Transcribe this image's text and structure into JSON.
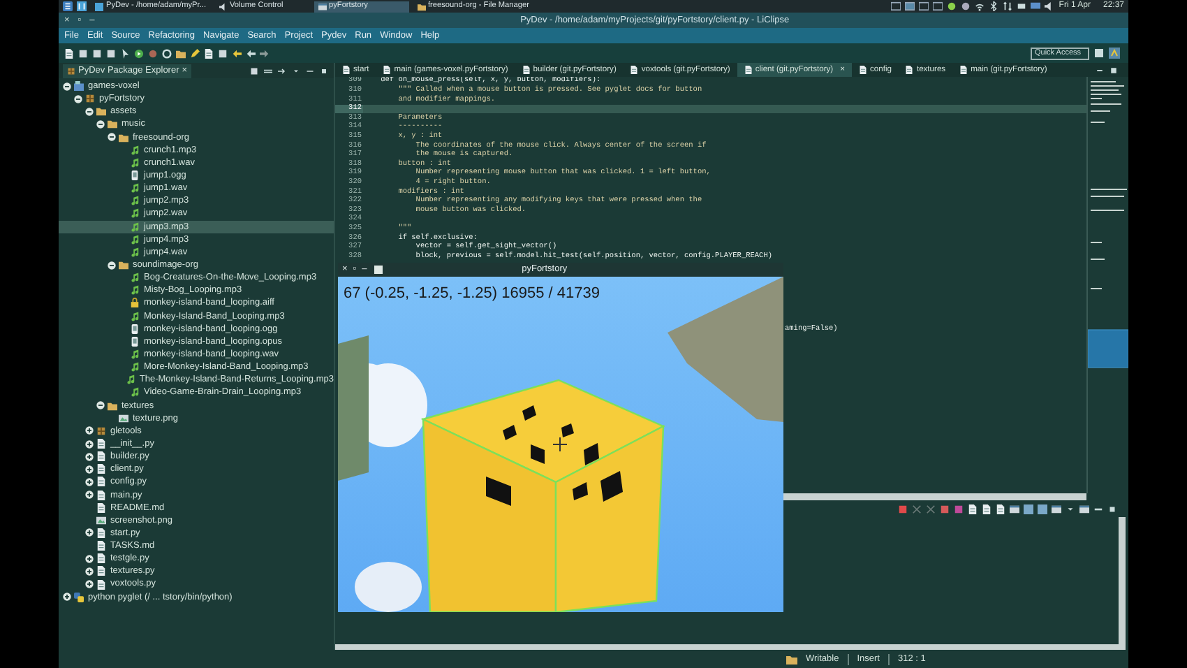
{
  "taskbar": {
    "windows": [
      {
        "title": "PyDev - /home/adam/myPr...",
        "selected": false
      },
      {
        "title": "Volume Control",
        "selected": false
      },
      {
        "title": "pyFortstory",
        "selected": true
      },
      {
        "title": "freesound-org - File Manager",
        "selected": false
      }
    ],
    "date": "Fri 1 Apr",
    "time": "22:37"
  },
  "window": {
    "title": "PyDev - /home/adam/myProjects/git/pyFortstory/client.py - LiClipse",
    "controls": [
      "×",
      "▫",
      "–"
    ]
  },
  "menu": [
    "File",
    "Edit",
    "Source",
    "Refactoring",
    "Navigate",
    "Search",
    "Project",
    "Pydev",
    "Run",
    "Window",
    "Help"
  ],
  "toolbar": {
    "quick_access": {
      "placeholder": "Quick Access"
    }
  },
  "package_explorer": {
    "title": "PyDev Package Explorer",
    "close": "×",
    "tree": [
      {
        "label": "games-voxel",
        "kind": "project",
        "expanded": true,
        "selected": false,
        "children": [
          {
            "label": "pyFortstory",
            "kind": "package",
            "expanded": true,
            "selected": false,
            "children": [
              {
                "label": "assets",
                "kind": "folder",
                "expanded": true,
                "selected": false,
                "children": [
                  {
                    "label": "music",
                    "kind": "folder",
                    "expanded": true,
                    "selected": false,
                    "children": [
                      {
                        "label": "freesound-org",
                        "kind": "folder",
                        "expanded": true,
                        "selected": false,
                        "children": [
                          {
                            "label": "crunch1.mp3",
                            "kind": "audio",
                            "selected": false
                          },
                          {
                            "label": "crunch1.wav",
                            "kind": "audio",
                            "selected": false
                          },
                          {
                            "label": "jump1.ogg",
                            "kind": "media",
                            "selected": false
                          },
                          {
                            "label": "jump1.wav",
                            "kind": "audio",
                            "selected": false
                          },
                          {
                            "label": "jump2.mp3",
                            "kind": "audio",
                            "selected": false
                          },
                          {
                            "label": "jump2.wav",
                            "kind": "audio",
                            "selected": false
                          },
                          {
                            "label": "jump3.mp3",
                            "kind": "audio",
                            "selected": true
                          },
                          {
                            "label": "jump4.mp3",
                            "kind": "audio",
                            "selected": false
                          },
                          {
                            "label": "jump4.wav",
                            "kind": "audio",
                            "selected": false
                          }
                        ]
                      },
                      {
                        "label": "soundimage-org",
                        "kind": "folder",
                        "expanded": true,
                        "selected": false,
                        "children": [
                          {
                            "label": "Bog-Creatures-On-the-Move_Looping.mp3",
                            "kind": "audio",
                            "selected": false
                          },
                          {
                            "label": "Misty-Bog_Looping.mp3",
                            "kind": "audio",
                            "selected": false
                          },
                          {
                            "label": "monkey-island-band_looping.aiff",
                            "kind": "lock",
                            "selected": false
                          },
                          {
                            "label": "Monkey-Island-Band_Looping.mp3",
                            "kind": "audio",
                            "selected": false
                          },
                          {
                            "label": "monkey-island-band_looping.ogg",
                            "kind": "media",
                            "selected": false
                          },
                          {
                            "label": "monkey-island-band_looping.opus",
                            "kind": "media",
                            "selected": false
                          },
                          {
                            "label": "monkey-island-band_looping.wav",
                            "kind": "audio",
                            "selected": false
                          },
                          {
                            "label": "More-Monkey-Island-Band_Looping.mp3",
                            "kind": "audio",
                            "selected": false
                          },
                          {
                            "label": "The-Monkey-Island-Band-Returns_Looping.mp3",
                            "kind": "audio",
                            "selected": false
                          },
                          {
                            "label": "Video-Game-Brain-Drain_Looping.mp3",
                            "kind": "audio",
                            "selected": false
                          }
                        ]
                      }
                    ]
                  },
                  {
                    "label": "textures",
                    "kind": "folder",
                    "expanded": true,
                    "selected": false,
                    "children": [
                      {
                        "label": "texture.png",
                        "kind": "image",
                        "selected": false
                      }
                    ]
                  }
                ]
              },
              {
                "label": "gletools",
                "kind": "package",
                "expanded": false,
                "selected": false
              },
              {
                "label": "__init__.py",
                "kind": "module",
                "expanded": false,
                "selected": false
              },
              {
                "label": "builder.py",
                "kind": "module",
                "expanded": false,
                "selected": false
              },
              {
                "label": "client.py",
                "kind": "module",
                "expanded": false,
                "selected": false
              },
              {
                "label": "config.py",
                "kind": "module",
                "expanded": false,
                "selected": false
              },
              {
                "label": "main.py",
                "kind": "module",
                "expanded": false,
                "selected": false
              },
              {
                "label": "README.md",
                "kind": "text",
                "selected": false
              },
              {
                "label": "screenshot.png",
                "kind": "image",
                "selected": false
              },
              {
                "label": "start.py",
                "kind": "module",
                "expanded": false,
                "selected": false
              },
              {
                "label": "TASKS.md",
                "kind": "text",
                "selected": false
              },
              {
                "label": "testgle.py",
                "kind": "module",
                "expanded": false,
                "selected": false
              },
              {
                "label": "textures.py",
                "kind": "module",
                "expanded": false,
                "selected": false
              },
              {
                "label": "voxtools.py",
                "kind": "module",
                "expanded": false,
                "selected": false
              }
            ]
          }
        ]
      },
      {
        "label": "python pyglet  (/ ... tstory/bin/python)",
        "kind": "interpreter",
        "expanded": false,
        "selected": false
      }
    ]
  },
  "editor_tabs": [
    {
      "label": "start",
      "selected": false
    },
    {
      "label": "main (games-voxel.pyFortstory)",
      "selected": false
    },
    {
      "label": "builder (git.pyFortstory)",
      "selected": false
    },
    {
      "label": "voxtools (git.pyFortstory)",
      "selected": false
    },
    {
      "label": "client (git.pyFortstory)",
      "selected": true,
      "close": "×"
    },
    {
      "label": "config",
      "selected": false
    },
    {
      "label": "textures",
      "selected": false
    },
    {
      "label": "main (git.pyFortstory)",
      "selected": false
    }
  ],
  "code_lines": [
    {
      "number": "309",
      "text": "    def on_mouse_press(self, x, y, button, modifiers):",
      "kind": "code",
      "current": false
    },
    {
      "number": "310",
      "text": "        \"\"\" Called when a mouse button is pressed. See pyglet docs for button",
      "kind": "doc",
      "current": false
    },
    {
      "number": "311",
      "text": "        and modifier mappings.",
      "kind": "doc",
      "current": false
    },
    {
      "number": "312",
      "current": true
    },
    {
      "number": "313",
      "text": "        Parameters",
      "kind": "doc",
      "current": false
    },
    {
      "number": "314",
      "text": "        ----------",
      "kind": "doc",
      "current": false
    },
    {
      "number": "315",
      "text": "        x, y : int",
      "kind": "doc",
      "current": false
    },
    {
      "number": "316",
      "text": "            The coordinates of the mouse click. Always center of the screen if",
      "kind": "doc",
      "current": false
    },
    {
      "number": "317",
      "text": "            the mouse is captured.",
      "kind": "doc",
      "current": false
    },
    {
      "number": "318",
      "text": "        button : int",
      "kind": "doc",
      "current": false
    },
    {
      "number": "319",
      "text": "            Number representing mouse button that was clicked. 1 = left button,",
      "kind": "doc",
      "current": false
    },
    {
      "number": "320",
      "text": "            4 = right button.",
      "kind": "doc",
      "current": false
    },
    {
      "number": "321",
      "text": "        modifiers : int",
      "kind": "doc",
      "current": false
    },
    {
      "number": "322",
      "text": "            Number representing any modifying keys that were pressed when the",
      "kind": "doc",
      "current": false
    },
    {
      "number": "323",
      "text": "            mouse button was clicked.",
      "kind": "doc",
      "current": false
    },
    {
      "number": "324",
      "current": false
    },
    {
      "number": "325",
      "text": "        \"\"\"",
      "kind": "doc",
      "current": false
    },
    {
      "number": "326",
      "text": "        if self.exclusive:",
      "kind": "code",
      "current": false
    },
    {
      "number": "327",
      "text": "            vector = self.get_sight_vector()",
      "kind": "code",
      "current": false
    },
    {
      "number": "328",
      "text": "            block, previous = self.model.hit_test(self.position, vector, config.PLAYER_REACH)",
      "kind": "code",
      "current": false
    }
  ],
  "code_fragment": "aming=False)",
  "game_window": {
    "title": "pyFortstory",
    "controls": [
      "×",
      "▫",
      "–"
    ],
    "hud": "67 (-0.25, -1.25, -1.25) 16955 / 41739"
  },
  "status_bar": {
    "access": "Writable",
    "mode": "Insert",
    "position": "312 : 1"
  }
}
